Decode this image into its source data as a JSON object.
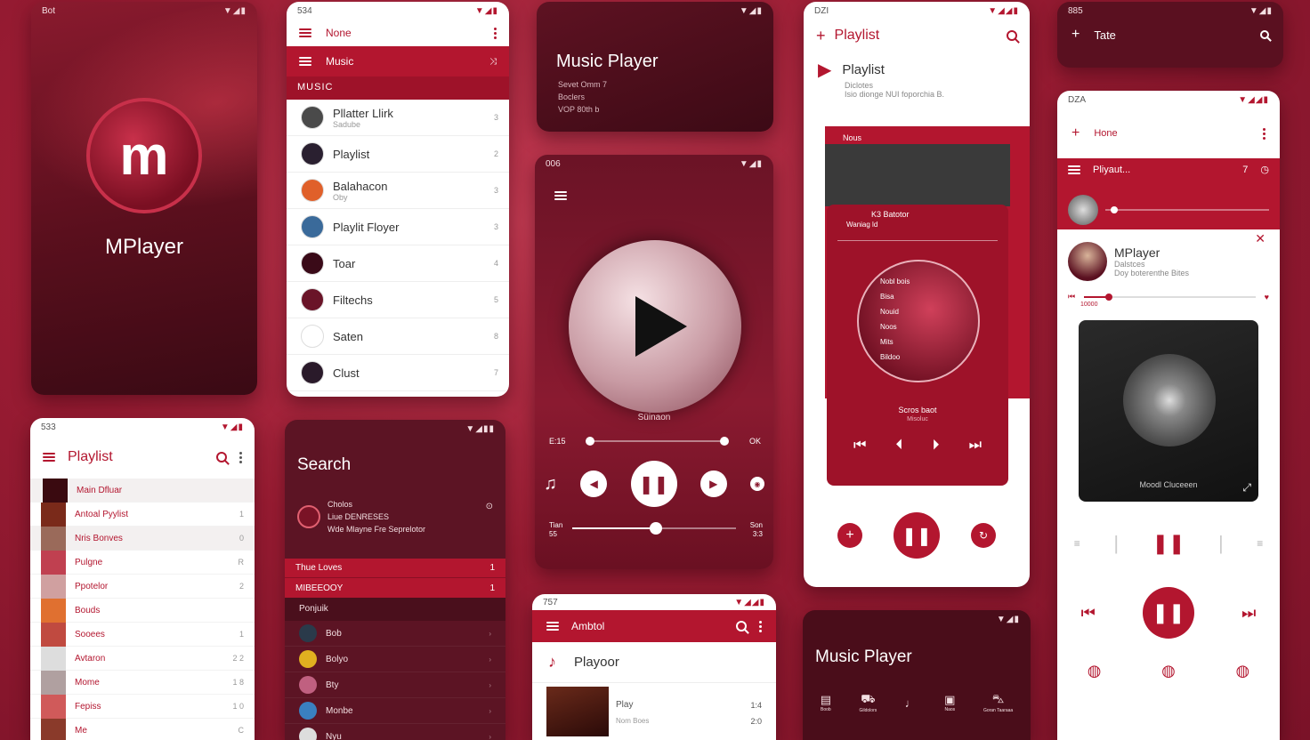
{
  "splash": {
    "status": "Bot",
    "signal": "▼◢▮",
    "brand": "MPlayer",
    "logo_letter": "m"
  },
  "music_list": {
    "status": "534",
    "signal": "▼◢▮",
    "top_label": "None",
    "bar_label": "Music",
    "section": "MUSIC",
    "items": [
      {
        "title": "Pllatter Llirk",
        "sub": "Sadube",
        "n": "3"
      },
      {
        "title": "Playlist",
        "sub": "",
        "n": "2"
      },
      {
        "title": "Balahacon",
        "sub": "Oby",
        "n": "3"
      },
      {
        "title": "Playlit Floyer",
        "sub": "",
        "n": "3"
      },
      {
        "title": "Toar",
        "sub": "",
        "n": "4"
      },
      {
        "title": "Filtechs",
        "sub": "",
        "n": "5"
      },
      {
        "title": "Saten",
        "sub": "",
        "n": "8"
      },
      {
        "title": "Clust",
        "sub": "",
        "n": "7"
      }
    ]
  },
  "header_card": {
    "signal": "▼◢▮",
    "title": "Music Player",
    "lines": [
      "Sevet Omm 7",
      "Boclers",
      "VOP 80th b"
    ]
  },
  "big_player": {
    "status": "006",
    "signal": "▼◢▮",
    "song_label": "Süinaon",
    "time_left": "E:15",
    "time_right": "OK",
    "vol_left": "Tian 55",
    "vol_right": "Son 3:3",
    "progress": 0.0,
    "volume": 0.5
  },
  "playlist_pop": {
    "status": "DZI",
    "signal": "▼◢◢▮",
    "title": "Playlist",
    "now_title": "Playlist",
    "now_sub1": "Diclotes",
    "now_sub2": "Isio dionge NUI foporchia B.",
    "band_label": "Nous",
    "pop_label": "K3 Batotor",
    "pop_sub": "Waniag ld",
    "pop_items": [
      "Nobl bois",
      "Bisa",
      "Nouid",
      "Noos",
      "Mits",
      "Bildoo"
    ],
    "pop_foot": "Scros baot",
    "pop_foot_sub": "Misoluc"
  },
  "right_top": {
    "status": "885",
    "signal": "▼◢▮",
    "title": "Tate"
  },
  "right_player": {
    "status": "DZA",
    "signal": "▼◢◢▮",
    "top_label": "Hone",
    "bar_label": "Pliyaut...",
    "bar_num": "7",
    "artist": "MPlayer",
    "sub1": "Dalstces",
    "sub2": "Doy boterenthe Bites",
    "time_left": "10000",
    "album_label": "Moodl Cluceeen",
    "progress": 0.15
  },
  "playlist_left": {
    "status": "533",
    "signal": "▼◢▮",
    "title": "Playlist",
    "items": [
      {
        "t": "Main Dfluar",
        "n": ""
      },
      {
        "t": "Antoal Pyylist",
        "n": "1"
      },
      {
        "t": "Nris Bonves",
        "n": "0"
      },
      {
        "t": "Pulgne",
        "n": "R"
      },
      {
        "t": "Ppotelor",
        "n": "2"
      },
      {
        "t": "Bouds",
        "n": ""
      },
      {
        "t": "Sooees",
        "n": "1"
      },
      {
        "t": "Avtaron",
        "n": "2   2"
      },
      {
        "t": "Mome",
        "n": "1   8"
      },
      {
        "t": "Fepiss",
        "n": "1   0"
      },
      {
        "t": "Me",
        "n": "C"
      }
    ]
  },
  "search": {
    "signal": "▼◢▮▮",
    "title": "Search",
    "res_title": "Cholos",
    "res_sub1": "Liue DENRESES",
    "res_sub2": "Wde Mlayne Fre Seprelotor",
    "band1": "Thue Loves",
    "band1_n": "1",
    "band2": "MIBEEOOY",
    "band2_n": "1",
    "sec": "Ponjuik",
    "items": [
      "Bob",
      "Bolyo",
      "Bty",
      "Monbe",
      "Nyu"
    ]
  },
  "bottom_mid": {
    "status": "757",
    "signal": "▼◢◢▮",
    "bar_label": "Ambtol",
    "title": "Playoor",
    "row_title": "Play",
    "row_sub": "Nom Boes",
    "row_n1": "1:4",
    "row_n2": "2:0"
  },
  "bottom_card": {
    "signal": "▼◢▮",
    "title": "Music Player",
    "tabs": [
      "Boob",
      "Gildolors",
      "",
      "Naos",
      "Goran Taaraaa"
    ]
  },
  "colors": {
    "crimson": "#b3162f",
    "dark": "#5c1424",
    "bg": "#9a1c33"
  }
}
